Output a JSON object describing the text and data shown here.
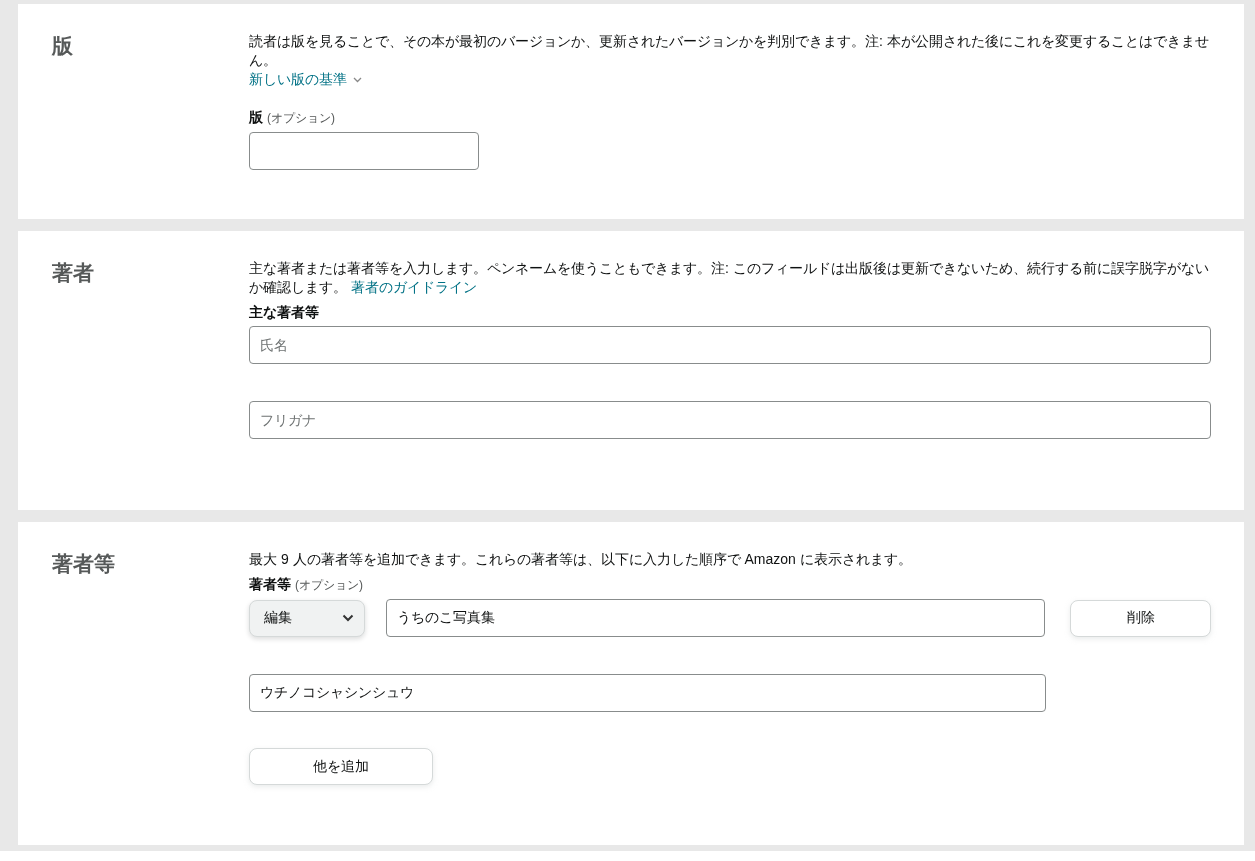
{
  "sections": [
    {
      "heading": "版",
      "description": "読者は版を見ることで、その本が最初のバージョンか、更新されたバージョンかを判別できます。注: 本が公開された後にこれを変更することはできません。",
      "link": {
        "kind": "disclosure",
        "label": "新しい版の基準",
        "expanded": false
      },
      "field_label": "版",
      "field_note": "(オプション)",
      "inputs": [
        {
          "kind": "short"
        }
      ]
    },
    {
      "heading": "著者",
      "description": "主な著者または著者等を入力します。ペンネームを使うこともできます。注: このフィールドは出版後は更新できないため、続行する前に誤字脱字がないか確認します。",
      "link": {
        "kind": "inline",
        "label": "著者のガイドライン"
      },
      "field_label": "主な著者等",
      "inputs": [
        {
          "kind": "wide",
          "placeholder": "氏名"
        },
        {
          "kind": "wide",
          "placeholder": "フリガナ"
        }
      ]
    },
    {
      "heading": "著者等",
      "description": "最大 9 人の著者等を追加できます。これらの著者等は、以下に入力した順序で Amazon に表示されます。",
      "field_label": "著者等",
      "field_note": "(オプション)",
      "contributors": [
        {
          "role": "編集",
          "name": "うちのこ写真集",
          "reading": "ウチノコシャシンシュウ",
          "remove_button": "削除"
        }
      ],
      "add_button": "他を追加"
    }
  ]
}
